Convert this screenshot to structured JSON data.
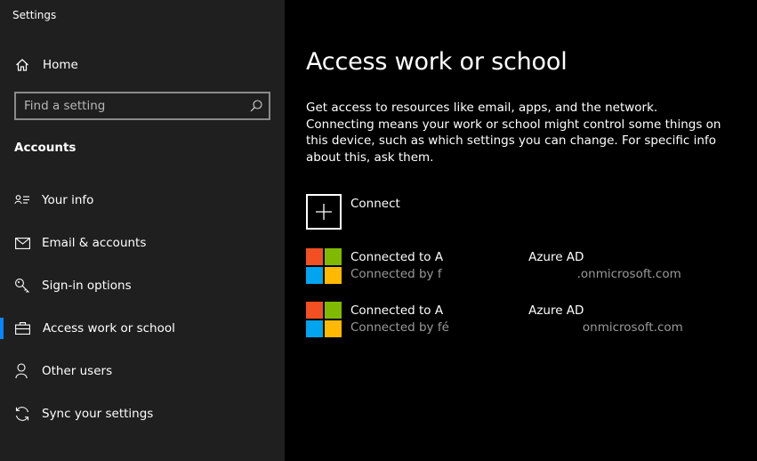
{
  "window": {
    "title": "Settings"
  },
  "sidebar": {
    "home_label": "Home",
    "search": {
      "placeholder": "Find a setting"
    },
    "section_header": "Accounts",
    "items": [
      {
        "label": "Your info",
        "icon": "contact-card-icon"
      },
      {
        "label": "Email & accounts",
        "icon": "mail-icon"
      },
      {
        "label": "Sign-in options",
        "icon": "key-icon"
      },
      {
        "label": "Access work or school",
        "icon": "briefcase-icon",
        "active": true
      },
      {
        "label": "Other users",
        "icon": "person-icon"
      },
      {
        "label": "Sync your settings",
        "icon": "sync-icon"
      }
    ]
  },
  "main": {
    "title": "Access work or school",
    "description": "Get access to resources like email, apps, and the network. Connecting means your work or school might control some things on this device, such as which settings you can change. For specific info about this, ask them.",
    "connect_label": "Connect",
    "accounts": [
      {
        "line1_prefix": "Connected to A",
        "line1_suffix": "Azure AD",
        "line2_prefix": "Connected by f",
        "line2_suffix": ".onmicrosoft.com"
      },
      {
        "line1_prefix": "Connected to A",
        "line1_suffix": "Azure AD",
        "line2_prefix": "Connected by fé",
        "line2_suffix": "onmicrosoft.com"
      }
    ]
  },
  "colors": {
    "sidebar_bg": "#1f1f1f",
    "main_bg": "#000000",
    "accent": "#0a84ff",
    "ms_red": "#f25022",
    "ms_green": "#7fba00",
    "ms_blue": "#00a4ef",
    "ms_yellow": "#ffb900",
    "secondary_text": "#9a9a9a"
  }
}
